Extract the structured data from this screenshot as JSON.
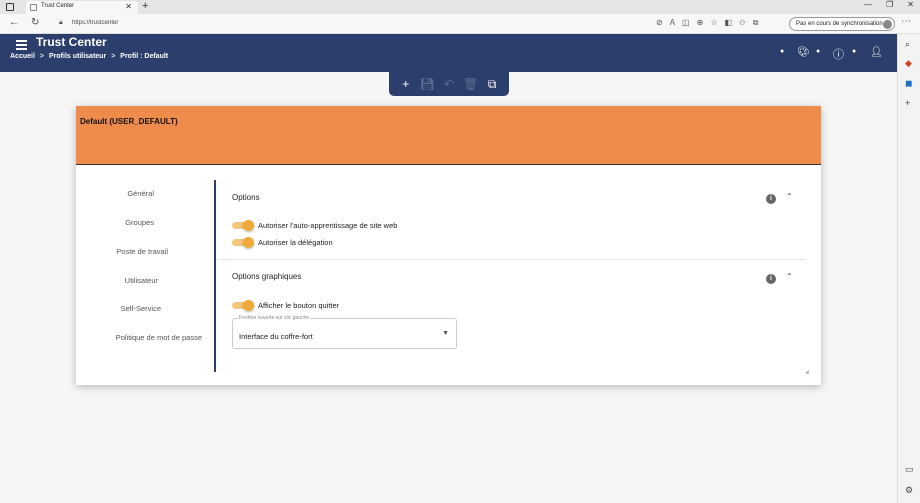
{
  "browser": {
    "tab_title": "Trust Center",
    "url": "https://trustcenter",
    "sync_label": "Pas en cours de synchronisation"
  },
  "header": {
    "app_title": "Trust Center",
    "breadcrumb": [
      "Accueil",
      "Profils utilisateur",
      "Profil : Default"
    ],
    "breadcrumb_sep": ">"
  },
  "card": {
    "title": "Default (USER_DEFAULT)",
    "accent_color": "#ef8c4c"
  },
  "side_nav": {
    "items": [
      "Général",
      "Groupes",
      "Poste de travail",
      "Utilisateur",
      "Self-Service",
      "Politique de mot de passe"
    ]
  },
  "sections": {
    "options": {
      "title": "Options",
      "toggles": [
        {
          "label": "Autoriser l'auto-apprentissage de site web",
          "on": true
        },
        {
          "label": "Autoriser la délégation",
          "on": true
        }
      ]
    },
    "graphic_options": {
      "title": "Options graphiques",
      "toggles": [
        {
          "label": "Afficher le bouton quitter",
          "on": true
        }
      ],
      "select": {
        "floating_label": "Fenêtre ouverte sur clic gauche",
        "value": "Interface du coffre-fort"
      }
    }
  },
  "colors": {
    "primary": "#2c3e6b",
    "toggle_on": "#f1a93a"
  },
  "icons": {
    "toolbar": [
      "add-icon",
      "save-icon",
      "undo-icon",
      "delete-icon",
      "copy-icon"
    ],
    "header_right": [
      "palette-icon",
      "help-icon",
      "user-icon"
    ]
  }
}
